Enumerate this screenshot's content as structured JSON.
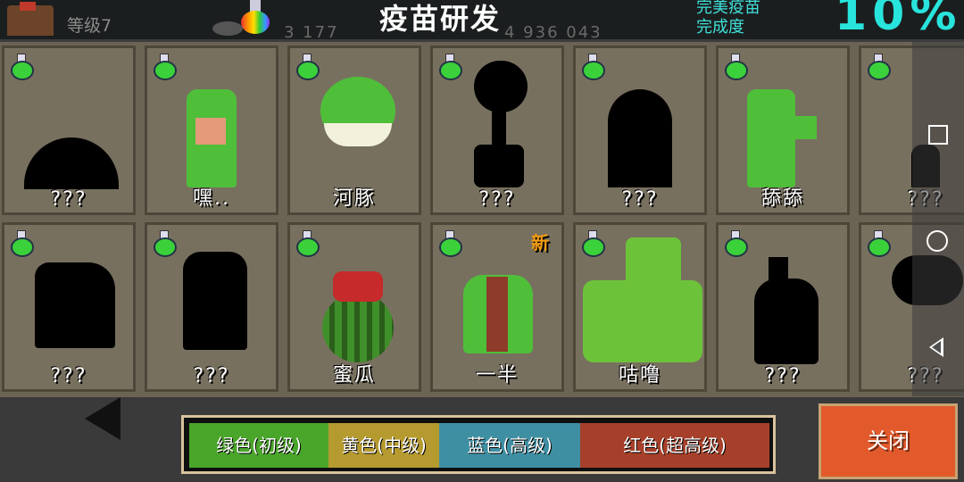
{
  "header": {
    "level": "等级7",
    "resource_a": "3 177",
    "title": "疫苗研发",
    "resource_b": "4 936 043",
    "completion_line1": "完美疫苗",
    "completion_line2": "完成度",
    "completion_percent": "10%",
    "flask_icon": "rainbow-flask-icon"
  },
  "cards": [
    {
      "name": "???",
      "new": ""
    },
    {
      "name": "嘿..",
      "new": ""
    },
    {
      "name": "河豚",
      "new": ""
    },
    {
      "name": "???",
      "new": ""
    },
    {
      "name": "???",
      "new": ""
    },
    {
      "name": "舔舔",
      "new": ""
    },
    {
      "name": "???",
      "new": ""
    },
    {
      "name": "???",
      "new": ""
    },
    {
      "name": "???",
      "new": ""
    },
    {
      "name": "蜜瓜",
      "new": ""
    },
    {
      "name": "一半",
      "new": "新"
    },
    {
      "name": "咕噜",
      "new": ""
    },
    {
      "name": "???",
      "new": ""
    },
    {
      "name": "???",
      "new": ""
    }
  ],
  "filters": {
    "green": "绿色(初级)",
    "yellow": "黄色(中级)",
    "blue": "蓝色(高级)",
    "red": "红色(超高级)"
  },
  "close_label": "关闭",
  "colors": {
    "accent": "#27e4dc",
    "close": "#e25a2c"
  }
}
